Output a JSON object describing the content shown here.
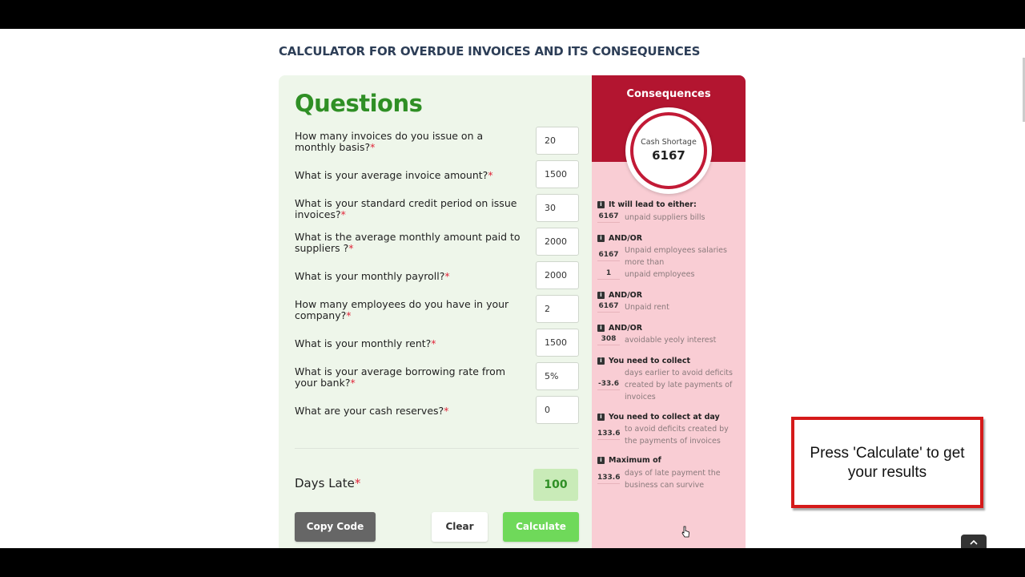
{
  "page": {
    "title": "CALCULATOR FOR OVERDUE INVOICES AND ITS CONSEQUENCES"
  },
  "questions": {
    "heading": "Questions",
    "items": [
      {
        "label": "How many invoices do you issue on a monthly basis?",
        "value": "20"
      },
      {
        "label": "What is your average invoice amount?",
        "value": "1500"
      },
      {
        "label": "What is your standard credit period on issue invoices?",
        "value": "30"
      },
      {
        "label": "What is the average monthly amount paid to suppliers ?",
        "value": "2000"
      },
      {
        "label": "What is your monthly payroll?",
        "value": "2000"
      },
      {
        "label": "How many employees do you have in your company?",
        "value": "2"
      },
      {
        "label": "What is your monthly rent?",
        "value": "1500"
      },
      {
        "label": "What is your average borrowing rate from your bank?",
        "value": "5%"
      },
      {
        "label": "What are your cash reserves?",
        "value": "0"
      }
    ],
    "required_mark": "*",
    "days_late_label": "Days Late",
    "days_late_value": "100"
  },
  "buttons": {
    "copy": "Copy Code",
    "clear": "Clear",
    "calculate": "Calculate"
  },
  "consequences": {
    "title": "Consequences",
    "ring_label": "Cash Shortage",
    "ring_value": "6167",
    "info_icon": "i",
    "blocks": [
      {
        "title": "It will lead to either:",
        "num": "6167",
        "text": "unpaid suppliers bills"
      },
      {
        "title": "AND/OR",
        "num": "6167",
        "text": "Unpaid employees salaries more than",
        "num2": "1",
        "text2": "unpaid employees"
      },
      {
        "title": "AND/OR",
        "num": "6167",
        "text": "Unpaid rent"
      },
      {
        "title": "AND/OR",
        "num": "308",
        "text": "avoidable yeoly interest"
      },
      {
        "title": "You need to collect",
        "num": "-33.6",
        "text": "days earlier to avoid deficits created by late payments of invoices"
      },
      {
        "title": "You need to collect at day",
        "num": "133.64",
        "text": "to avoid deficits created by the payments of invoices"
      },
      {
        "title": "Maximum of",
        "num": "133.64",
        "text": "days of late payment the business can survive"
      }
    ]
  },
  "callout": {
    "text": "Press 'Calculate' to get your results"
  },
  "colors": {
    "question_green": "#2f8f25",
    "consequence_red": "#b31530",
    "consequence_bg": "#f9cdd4",
    "calculate_green": "#6fd95a"
  },
  "icons": [
    "info-icon",
    "chevron-up-icon",
    "hand-cursor-icon"
  ]
}
